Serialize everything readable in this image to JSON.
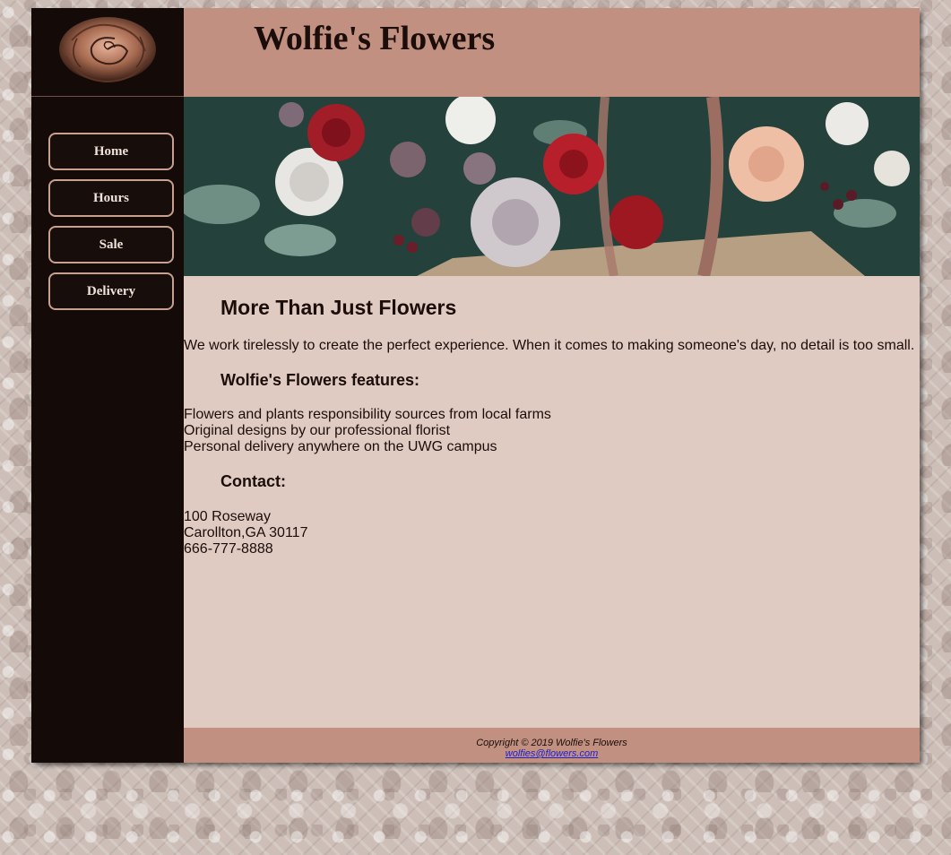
{
  "header": {
    "title": "Wolfie's Flowers",
    "logo_icon": "rose-icon"
  },
  "nav": {
    "items": [
      {
        "label": "Home"
      },
      {
        "label": "Hours"
      },
      {
        "label": "Sale"
      },
      {
        "label": "Delivery"
      }
    ]
  },
  "hero": {
    "image": "flower-basket-photo"
  },
  "main": {
    "heading": "More Than Just Flowers",
    "intro": "We work tirelessly to create the perfect experience. When it comes to making someone's day, no detail is too small.",
    "features_heading": "Wolfie's Flowers features:",
    "features": [
      "Flowers and plants responsibility sources from local farms",
      "Original designs by our professional florist",
      "Personal delivery anywhere on the UWG campus"
    ],
    "contact_heading": "Contact:",
    "contact": [
      "100 Roseway",
      "Carollton,GA 30117",
      "666-777-8888"
    ]
  },
  "footer": {
    "copyright": "Copyright © 2019 Wolfie's Flowers",
    "email": "wolfies@flowers.com"
  },
  "colors": {
    "dark": "#140b09",
    "header": "#c19080",
    "content": "#e0cbc2",
    "button_border": "#c7a08f"
  }
}
